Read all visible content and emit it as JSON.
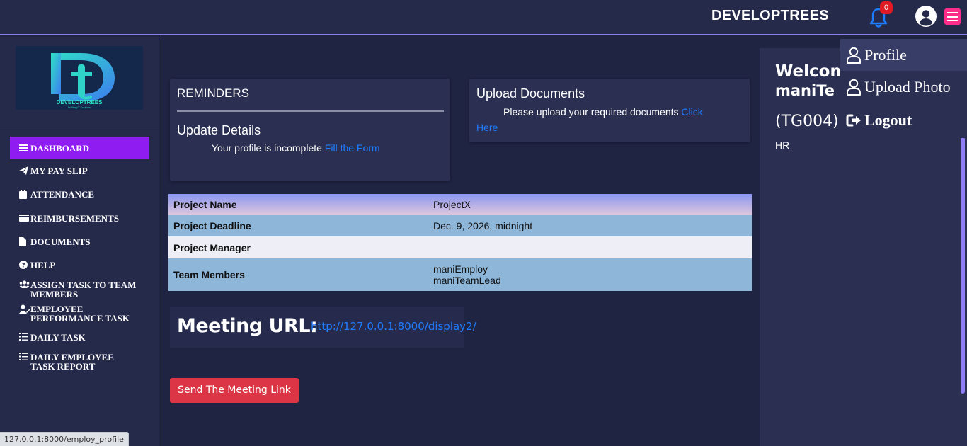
{
  "header": {
    "brand": "DEVELOPTREES",
    "notification_count": "0",
    "bell_icon": "bell-icon",
    "user_icon": "user-circle-icon",
    "menu_icon": "hamburger-icon",
    "accent_color": "#ff2d8a"
  },
  "sidebar": {
    "logo_alt": "DEVELOPTREES",
    "logo_subtitle": "Building IT Solutions",
    "items": [
      {
        "label": "DASHBOARD",
        "icon": "bars-icon",
        "active": true
      },
      {
        "label": "MY PAY SLIP",
        "icon": "paper-plane-icon"
      },
      {
        "label": "ATTENDANCE",
        "icon": "calendar-icon"
      },
      {
        "label": "REIMBURSEMENTS",
        "icon": "credit-card-icon"
      },
      {
        "label": "DOCUMENTS",
        "icon": "file-icon"
      },
      {
        "label": "HELP",
        "icon": "question-circle-icon"
      },
      {
        "label": "ASSIGN TASK TO TEAM MEMBERS",
        "icon": "users-icon"
      },
      {
        "label": "EMPLOYEE PERFORMANCE TASK",
        "icon": "user-edit-icon"
      },
      {
        "label": "DAILY TASK",
        "icon": "list-check-icon"
      },
      {
        "label": "DAILY EMPLOYEE TASK REPORT",
        "icon": "list-check-icon"
      }
    ],
    "active_color": "#8f1df2"
  },
  "reminders": {
    "title": "REMINDERS",
    "update_title": "Update Details",
    "text": "Your profile is incomplete",
    "link": "Fill the Form"
  },
  "upload": {
    "title": "Upload Documents",
    "text": "Please upload your required documents",
    "link_1": "Click",
    "link_2": "Here"
  },
  "project": {
    "rows": [
      {
        "key": "Project Name",
        "value": "ProjectX"
      },
      {
        "key": "Project Deadline",
        "value": "Dec. 9, 2026, midnight"
      },
      {
        "key": "Project Manager",
        "value": ""
      },
      {
        "key": "Team Members",
        "value": "maniEmploy",
        "value_2": "maniTeamLead"
      }
    ]
  },
  "meeting": {
    "label": "Meeting URL:",
    "url": "http://127.0.0.1:8000/display2/",
    "send_button": "Send The Meeting Link",
    "button_color": "#dc3545"
  },
  "profile_panel": {
    "welcome": "Welcom",
    "name": "maniTe",
    "employee_id": "(TG004)",
    "department": "HR"
  },
  "dropdown": {
    "items": [
      {
        "label": "Profile",
        "icon": "user-outline-icon"
      },
      {
        "label": "Upload Photo",
        "icon": "user-outline-icon"
      },
      {
        "label": "Logout",
        "icon": "sign-out-icon"
      }
    ]
  },
  "status_bar": {
    "url": "127.0.0.1:8000/employ_profile"
  }
}
